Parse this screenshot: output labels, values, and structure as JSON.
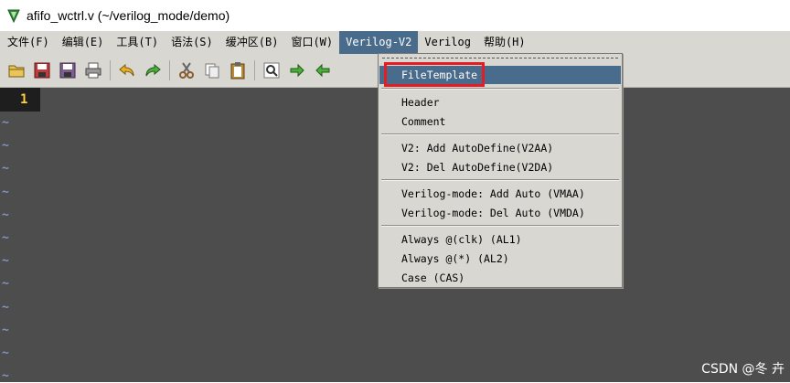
{
  "window": {
    "title": "afifo_wctrl.v (~/verilog_mode/demo)",
    "icon": "gvim-icon"
  },
  "menubar": {
    "items": [
      {
        "label": "文件(F)"
      },
      {
        "label": "编辑(E)"
      },
      {
        "label": "工具(T)"
      },
      {
        "label": "语法(S)"
      },
      {
        "label": "缓冲区(B)"
      },
      {
        "label": "窗口(W)"
      },
      {
        "label": "Verilog-V2",
        "active": true
      },
      {
        "label": "Verilog"
      },
      {
        "label": "帮助(H)"
      }
    ]
  },
  "toolbar": {
    "icons": [
      "open-icon",
      "save-icon",
      "save-all-icon",
      "print-icon",
      "undo-icon",
      "redo-icon",
      "cut-icon",
      "copy-icon",
      "paste-icon",
      "find-replace-icon",
      "find-next-icon",
      "find-prev-icon"
    ]
  },
  "tabline": {
    "tab_number": "1"
  },
  "editor": {
    "empty_line_marker": "~",
    "marker_count": 12
  },
  "dropdown": {
    "items": [
      {
        "label": "FileTemplate",
        "selected": true
      },
      {
        "separator": true
      },
      {
        "label": "Header"
      },
      {
        "label": "Comment"
      },
      {
        "separator": true
      },
      {
        "label": "V2: Add AutoDefine(V2AA)"
      },
      {
        "label": "V2: Del AutoDefine(V2DA)"
      },
      {
        "separator": true
      },
      {
        "label": "Verilog-mode: Add Auto (VMAA)"
      },
      {
        "label": "Verilog-mode: Del Auto (VMDA)"
      },
      {
        "separator": true
      },
      {
        "label": "Always @(clk) (AL1)"
      },
      {
        "label": "Always @(*) (AL2)"
      },
      {
        "label": "Case (CAS)"
      }
    ]
  },
  "watermark": {
    "text": "CSDN @冬 卉"
  },
  "colors": {
    "menu_bg": "#d9d7d2",
    "selection": "#4a6c8c",
    "editor_bg": "#4d4d4d",
    "tilde": "#7f95c3",
    "tab_number": "#ffd23a",
    "annotation_box": "#e51c23"
  }
}
